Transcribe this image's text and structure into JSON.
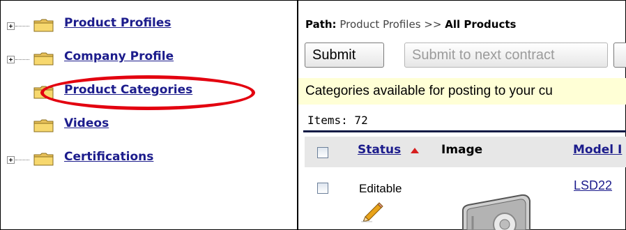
{
  "tree": {
    "items": [
      {
        "label": "Product Profiles",
        "expandable": true
      },
      {
        "label": "Company Profile",
        "expandable": true
      },
      {
        "label": "Product Categories",
        "expandable": false
      },
      {
        "label": "Videos",
        "expandable": false
      },
      {
        "label": "Certifications",
        "expandable": true
      }
    ]
  },
  "path": {
    "prefix": "Path:",
    "trail": "Product Profiles >>",
    "current": "All Products"
  },
  "toolbar": {
    "submit_label": "Submit",
    "submit_next_label": "Submit to next contract"
  },
  "info": {
    "text": "Categories available for posting to your cu"
  },
  "items_count": "Items: 72",
  "table": {
    "headers": {
      "status": "Status",
      "image": "Image",
      "model": "Model I"
    },
    "rows": [
      {
        "status": "Editable",
        "model": "LSD22",
        "edit_icon": "pencil-icon"
      }
    ]
  },
  "colors": {
    "link": "#1c1c8c",
    "highlight": "#e3000f",
    "info_bg": "#ffffd6",
    "sort_arrow": "#d61f1f"
  }
}
